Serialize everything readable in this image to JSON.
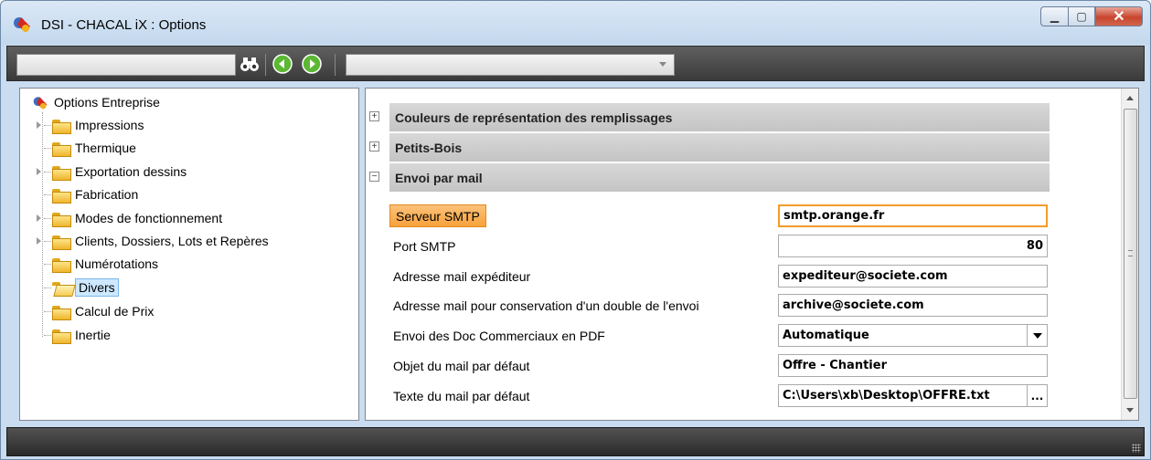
{
  "window": {
    "title": "DSI - CHACAL iX : Options",
    "controls": [
      "minimize",
      "maximize",
      "close"
    ]
  },
  "toolbar": {
    "search_value": "",
    "combo_value": "",
    "icons": [
      "binoculars-icon",
      "back-arrow-icon",
      "forward-arrow-icon"
    ]
  },
  "tree": {
    "root": "Options Entreprise",
    "items": [
      {
        "label": "Impressions",
        "expandable": true
      },
      {
        "label": "Thermique",
        "expandable": false
      },
      {
        "label": "Exportation dessins",
        "expandable": true
      },
      {
        "label": "Fabrication",
        "expandable": false
      },
      {
        "label": "Modes de fonctionnement",
        "expandable": true
      },
      {
        "label": "Clients, Dossiers, Lots et Repères",
        "expandable": true
      },
      {
        "label": "Numérotations",
        "expandable": false
      },
      {
        "label": "Divers",
        "expandable": false,
        "selected": true
      },
      {
        "label": "Calcul de Prix",
        "expandable": false
      },
      {
        "label": "Inertie",
        "expandable": false
      }
    ]
  },
  "sections": [
    {
      "label": "Couleurs de représentation des remplissages",
      "toggle": "+"
    },
    {
      "label": "Petits-Bois",
      "toggle": "+"
    },
    {
      "label": "Envoi par mail",
      "toggle": "−"
    }
  ],
  "fields": [
    {
      "label": "Serveur SMTP",
      "value": "smtp.orange.fr"
    },
    {
      "label": "Port SMTP",
      "value": "80"
    },
    {
      "label": "Adresse mail expéditeur",
      "value": "expediteur@societe.com"
    },
    {
      "label": "Adresse mail pour conservation d'un double de l'envoi",
      "value": "archive@societe.com"
    },
    {
      "label": "Envoi des Doc Commerciaux en PDF",
      "value": "Automatique"
    },
    {
      "label": "Objet du mail par défaut",
      "value": "Offre - Chantier"
    },
    {
      "label": "Texte du mail par défaut",
      "value": "C:\\Users\\xb\\Desktop\\OFFRE.txt",
      "button": "..."
    }
  ],
  "colors": {
    "highlight": "#f8a13a",
    "section_bg": "#cccccc",
    "selection": "#cde8ff"
  }
}
